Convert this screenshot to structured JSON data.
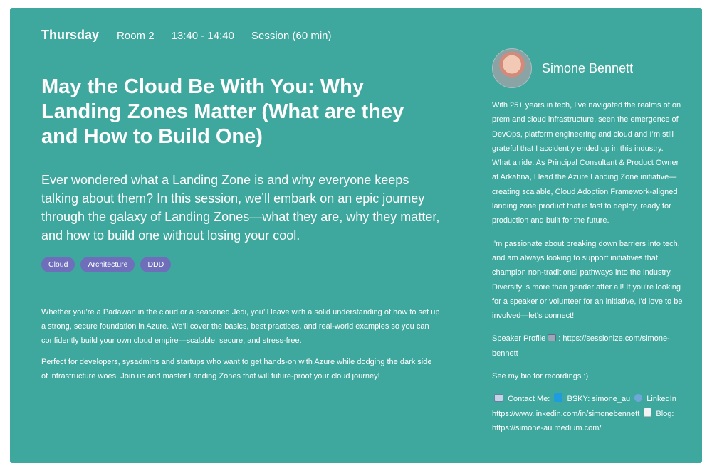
{
  "session": {
    "day": "Thursday",
    "room": "Room 2",
    "time": "13:40 - 14:40",
    "format": "Session (60 min)",
    "title": "May the Cloud Be With You: Why Landing Zones Matter (What are they and How to Build One)",
    "abstract": "Ever wondered what a Landing Zone is and why everyone keeps talking about them? In this session, we’ll embark on an epic journey through the galaxy of Landing Zones—what they are, why they matter, and how to build one without losing your cool.",
    "tags": [
      "Cloud",
      "Architecture",
      "DDD"
    ],
    "description": [
      "Whether you’re a Padawan in the cloud or a seasoned Jedi, you’ll leave with a solid understanding of how to set up a strong, secure foundation in Azure. We’ll cover the basics, best practices, and real-world examples so you can confidently build your own cloud empire—scalable, secure, and stress-free.",
      "Perfect for developers, sysadmins and startups who want to get hands-on with Azure while dodging the dark side of infrastructure woes. Join us and master Landing Zones that will future-proof your cloud journey!"
    ]
  },
  "speaker": {
    "name": "Simone Bennett",
    "bio_1": "With 25+ years in tech, I’ve navigated the realms of on prem and cloud infrastructure, seen the emergence of DevOps, platform engineering and cloud and I’m still grateful that I accidently ended up in this industry. What a ride. As Principal Consultant & Product Owner at Arkahna, I lead the Azure Landing Zone initiative—creating scalable, Cloud Adoption Framework-aligned landing zone product that is fast to deploy, ready for production and built for the future.",
    "bio_2": "I'm passionate about breaking down barriers into tech, and am always looking to support initiatives that champion non-traditional pathways into the industry. Diversity is more than gender after all! If you're looking for a speaker or volunteer for an initiative, I'd love to be involved—let's connect!",
    "profile_label": "Speaker Profile",
    "profile_url": ": https://sessionize.com/simone-bennett",
    "recordings": "See my bio for recordings :)",
    "contact_label": "Contact Me:",
    "bsky": "BSKY: simone_au",
    "linkedin_label": "LinkedIn",
    "linkedin_url": "https://www.linkedin.com/in/simonebennett",
    "blog_label": "Blog:",
    "blog_url": "https://simone-au.medium.com/"
  },
  "icons": {
    "profile": "computer-icon",
    "contact": "contact-card-icon",
    "bsky": "blue-square-icon",
    "linkedin": "globe-icon",
    "blog": "document-icon"
  },
  "colors": {
    "card": "#3fa89e",
    "tag": "#6e6ebb"
  }
}
